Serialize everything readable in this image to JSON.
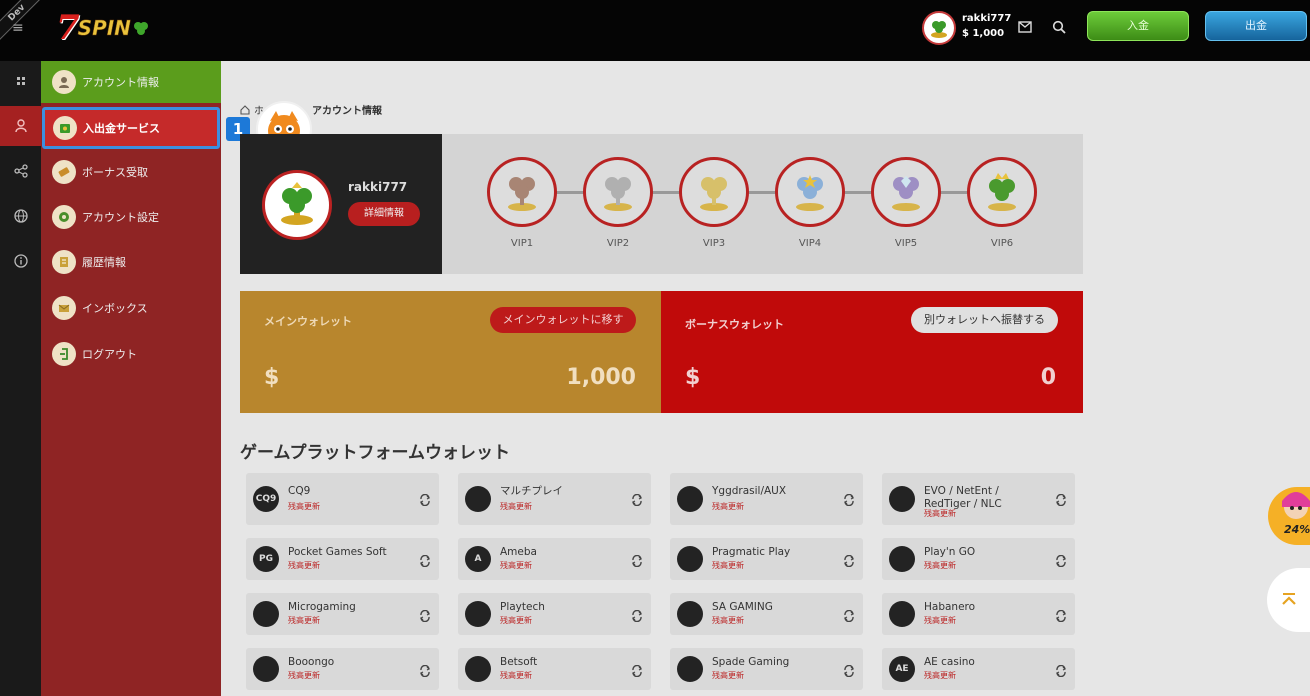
{
  "header": {
    "dev_label": "Dev",
    "logo_seven": "7",
    "logo_spin": "SPIN",
    "user_name": "rakki777",
    "user_balance": "$ 1,000",
    "deposit_label": "入金",
    "withdraw_label": "出金"
  },
  "sidebar": {
    "items": [
      {
        "label": "アカウント情報"
      },
      {
        "label": "入出金サービス"
      },
      {
        "label": "ボーナス受取"
      },
      {
        "label": "アカウント設定"
      },
      {
        "label": "履歴情報"
      },
      {
        "label": "インボックス"
      },
      {
        "label": "ログアウト"
      }
    ]
  },
  "breadcrumb": {
    "home": "ホ",
    "current": "アカウント情報"
  },
  "annotation_number": "1",
  "profile": {
    "name": "rakki777",
    "detail_label": "詳細情報"
  },
  "vip_levels": [
    "VIP1",
    "VIP2",
    "VIP3",
    "VIP4",
    "VIP5",
    "VIP6"
  ],
  "wallets": {
    "main": {
      "title": "メインウォレット",
      "button": "メインウォレットに移す",
      "currency": "$",
      "amount": "1,000"
    },
    "bonus": {
      "title": "ボーナスウォレット",
      "button": "別ウォレットへ振替する",
      "currency": "$",
      "amount": "0"
    }
  },
  "platform_section_title": "ゲームプラットフォームウォレット",
  "platforms": [
    {
      "name": "CQ9",
      "update": "残高更新",
      "icon_text": "CQ9"
    },
    {
      "name": "マルチプレイ",
      "update": "残高更新",
      "icon_text": ""
    },
    {
      "name": "Yggdrasil/AUX",
      "update": "残高更新",
      "icon_text": ""
    },
    {
      "name": "EVO / NetEnt / RedTiger / NLC",
      "update": "残高更新",
      "icon_text": ""
    },
    {
      "name": "Pocket Games Soft",
      "update": "残高更新",
      "icon_text": "PG"
    },
    {
      "name": "Ameba",
      "update": "残高更新",
      "icon_text": "A"
    },
    {
      "name": "Pragmatic Play",
      "update": "残高更新",
      "icon_text": ""
    },
    {
      "name": "Play'n GO",
      "update": "残高更新",
      "icon_text": ""
    },
    {
      "name": "Microgaming",
      "update": "残高更新",
      "icon_text": ""
    },
    {
      "name": "Playtech",
      "update": "残高更新",
      "icon_text": ""
    },
    {
      "name": "SA GAMING",
      "update": "残高更新",
      "icon_text": ""
    },
    {
      "name": "Habanero",
      "update": "残高更新",
      "icon_text": ""
    },
    {
      "name": "Booongo",
      "update": "残高更新",
      "icon_text": ""
    },
    {
      "name": "Betsoft",
      "update": "残高更新",
      "icon_text": ""
    },
    {
      "name": "Spade Gaming",
      "update": "残高更新",
      "icon_text": ""
    },
    {
      "name": "AE casino",
      "update": "残高更新",
      "icon_text": "AE"
    }
  ],
  "floating_promo_percent": "24%",
  "colors": {
    "sidebar": "#8f2424",
    "active": "#c52a2a",
    "highlight_border": "#3d8fe0",
    "main_wallet": "#b8862d",
    "bonus_wallet": "#c00a0a"
  }
}
